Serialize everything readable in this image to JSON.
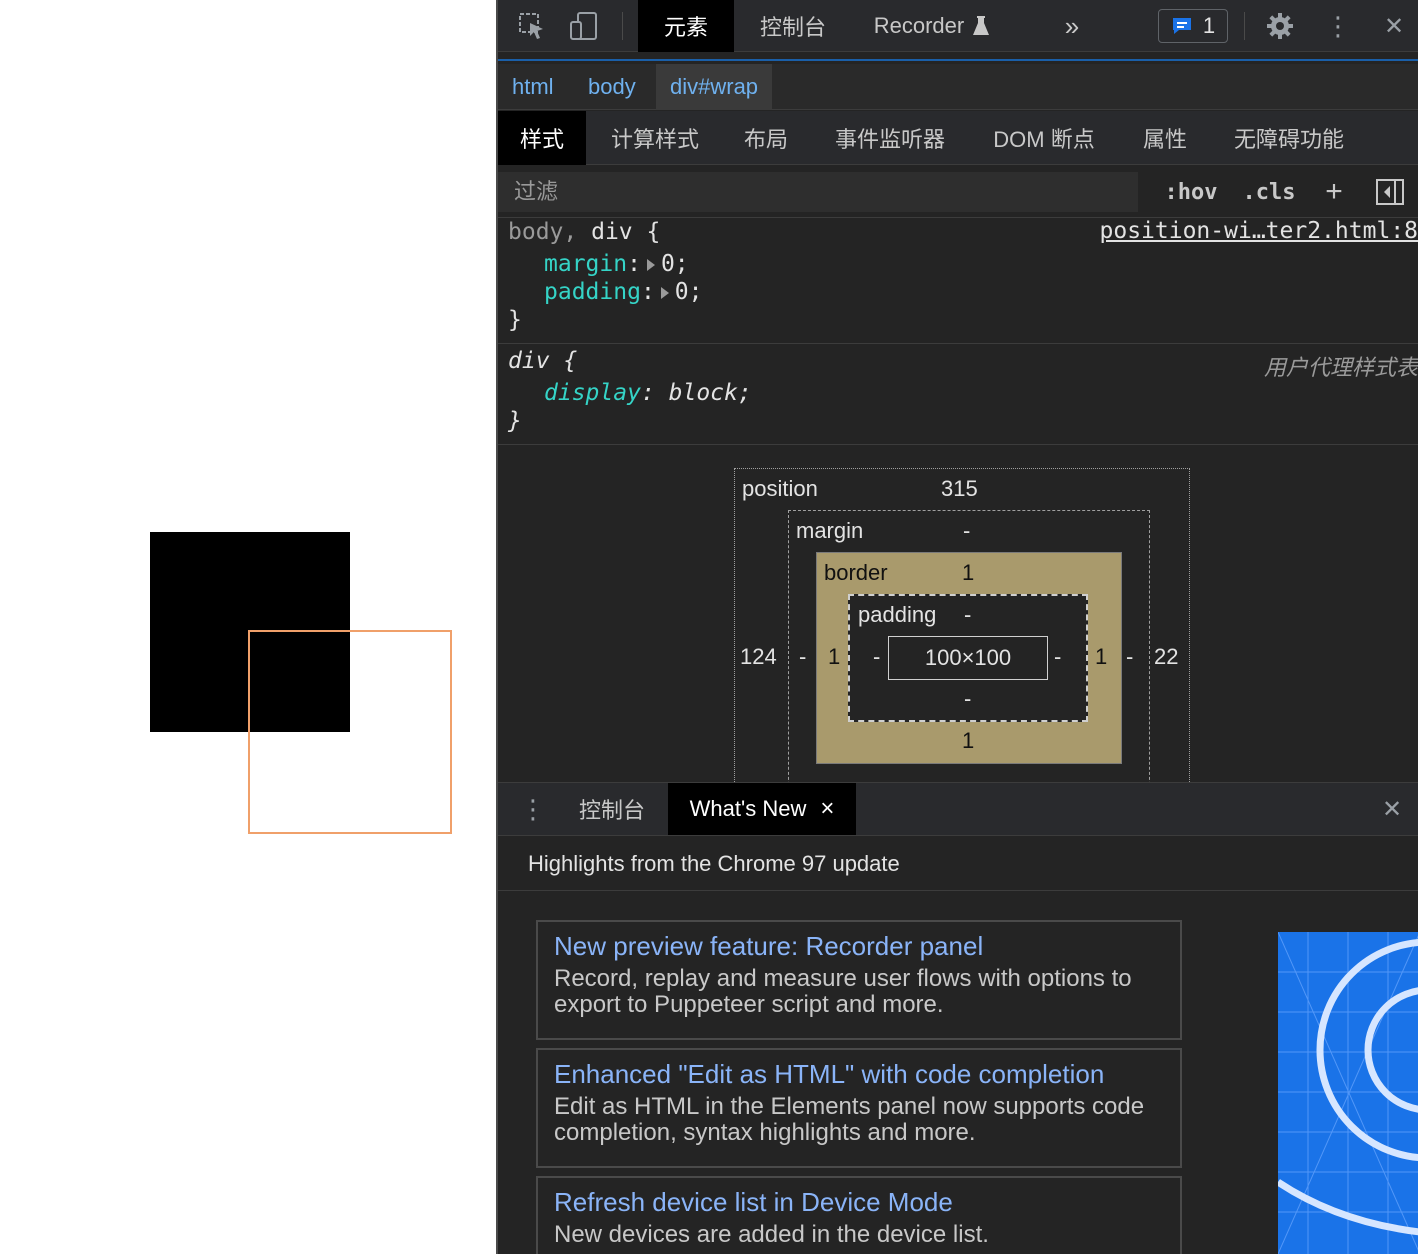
{
  "page": {
    "black_box_label": "",
    "outline_color": "#f0a06a"
  },
  "toolbar": {
    "inspect_icon": "inspect-element-icon",
    "device_icon": "device-toolbar-icon",
    "tabs": [
      "元素",
      "控制台",
      "Recorder"
    ],
    "more_icon": "»",
    "message_count": "1",
    "settings_icon": "gear-icon",
    "kebab_icon": "⋮",
    "close_icon": "✕"
  },
  "breadcrumbs": [
    "html",
    "body",
    "div#wrap"
  ],
  "subtabs": [
    "样式",
    "计算样式",
    "布局",
    "事件监听器",
    "DOM 断点",
    "属性",
    "无障碍功能"
  ],
  "filter": {
    "placeholder": "过滤",
    "hov": ":hov",
    "cls": ".cls",
    "plus": "+",
    "toggle_icon": "sidebar-toggle-icon"
  },
  "rules": {
    "rule1": {
      "selector_dim": "body,",
      "selector_bright": " div {",
      "source": "position-wi…ter2.html:8",
      "decls": [
        {
          "prop": "margin",
          "val": "0;"
        },
        {
          "prop": "padding",
          "val": "0;"
        }
      ],
      "close": "}"
    },
    "rule2": {
      "selector": "div {",
      "source": "用户代理样式表",
      "decls": [
        {
          "prop": "display",
          "val": "block;"
        }
      ],
      "close": "}"
    }
  },
  "boxmodel": {
    "position_label": "position",
    "position_top": "315",
    "position_left": "124",
    "position_right": "22",
    "margin_label": "margin",
    "margin_top": "-",
    "margin_left": "-",
    "margin_right": "-",
    "border_label": "border",
    "border_top": "1",
    "border_left": "1",
    "border_right": "1",
    "border_bottom": "1",
    "padding_label": "padding",
    "padding_top": "-",
    "padding_left": "-",
    "padding_right": "-",
    "padding_bottom": "-",
    "content": "100×100"
  },
  "drawer": {
    "tabs": [
      "控制台",
      "What's New"
    ],
    "tab_close": "×",
    "close": "✕",
    "heading": "Highlights from the Chrome 97 update",
    "cards": [
      {
        "title": "New preview feature: Recorder panel",
        "desc": "Record, replay and measure user flows with options to export to Puppeteer script and more."
      },
      {
        "title": "Enhanced \"Edit as HTML\" with code completion",
        "desc": "Edit as HTML in the Elements panel now supports code completion, syntax highlights and more."
      },
      {
        "title": "Refresh device list in Device Mode",
        "desc": "New devices are added in the device list."
      }
    ]
  },
  "colors": {
    "accent_blue": "#8ab4f8",
    "css_property": "#35d4c7",
    "border_box": "#a99a6c",
    "hero_blue": "#1a73e8"
  }
}
